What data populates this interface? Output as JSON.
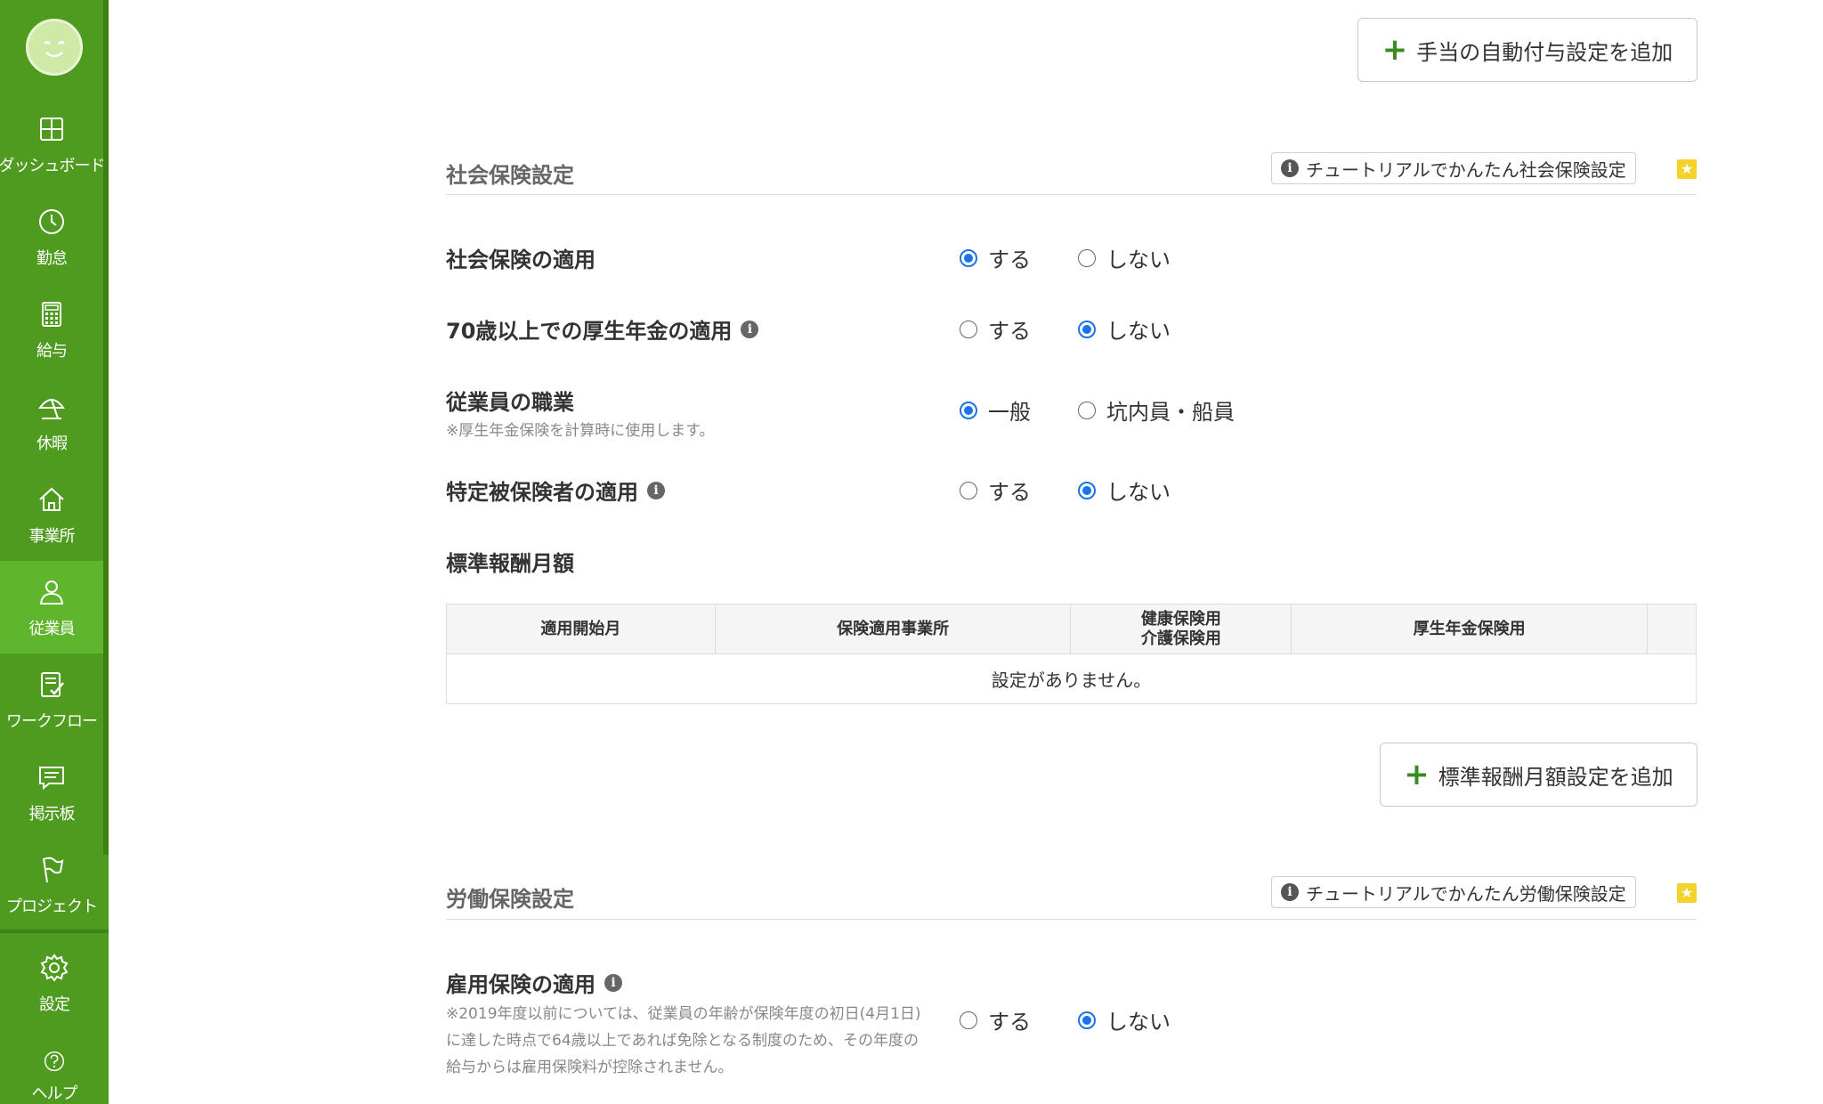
{
  "sidebar": {
    "items": [
      {
        "label": "ダッシュボード",
        "icon": "dashboard-icon"
      },
      {
        "label": "勤怠",
        "icon": "clock-icon"
      },
      {
        "label": "給与",
        "icon": "calculator-icon"
      },
      {
        "label": "休暇",
        "icon": "umbrella-icon"
      },
      {
        "label": "事業所",
        "icon": "home-icon"
      },
      {
        "label": "従業員",
        "icon": "person-icon"
      },
      {
        "label": "ワークフロー",
        "icon": "checklist-icon"
      },
      {
        "label": "掲示板",
        "icon": "message-icon"
      },
      {
        "label": "プロジェクト",
        "icon": "flag-icon"
      },
      {
        "label": "設定",
        "icon": "gear-icon"
      },
      {
        "label": "ヘルプ",
        "icon": "help-icon"
      }
    ],
    "active": "従業員",
    "accent": "#4f9b1f"
  },
  "top_button": {
    "label": "手当の自動付与設定を追加"
  },
  "social": {
    "title": "社会保険設定",
    "tutorial": "チュートリアルでかんたん社会保険設定",
    "rows": {
      "apply": {
        "label": "社会保険の適用",
        "opt1": "する",
        "opt2": "しない",
        "selected": "する"
      },
      "pension70": {
        "label": "70歳以上での厚生年金の適用",
        "opt1": "する",
        "opt2": "しない",
        "selected": "しない"
      },
      "occupation": {
        "label": "従業員の職業",
        "note": "※厚生年金保険を計算時に使用します。",
        "opt1": "一般",
        "opt2": "坑内員・船員",
        "selected": "一般"
      },
      "specific": {
        "label": "特定被保険者の適用",
        "opt1": "する",
        "opt2": "しない",
        "selected": "しない"
      }
    },
    "standard": {
      "title": "標準報酬月額",
      "columns": [
        "適用開始月",
        "保険適用事業所",
        "健康保険用",
        "介護保険用",
        "厚生年金保険用"
      ],
      "empty": "設定がありません。",
      "add_button": "標準報酬月額設定を追加"
    }
  },
  "labor": {
    "title": "労働保険設定",
    "tutorial": "チュートリアルでかんたん労働保険設定",
    "employment": {
      "label": "雇用保険の適用",
      "note": "※2019年度以前については、従業員の年齢が保険年度の初日(4月1日)に達した時点で64歳以上であれば免除となる制度のため、その年度の給与からは雇用保険料が控除されません。",
      "opt1": "する",
      "opt2": "しない",
      "selected": "しない"
    }
  }
}
